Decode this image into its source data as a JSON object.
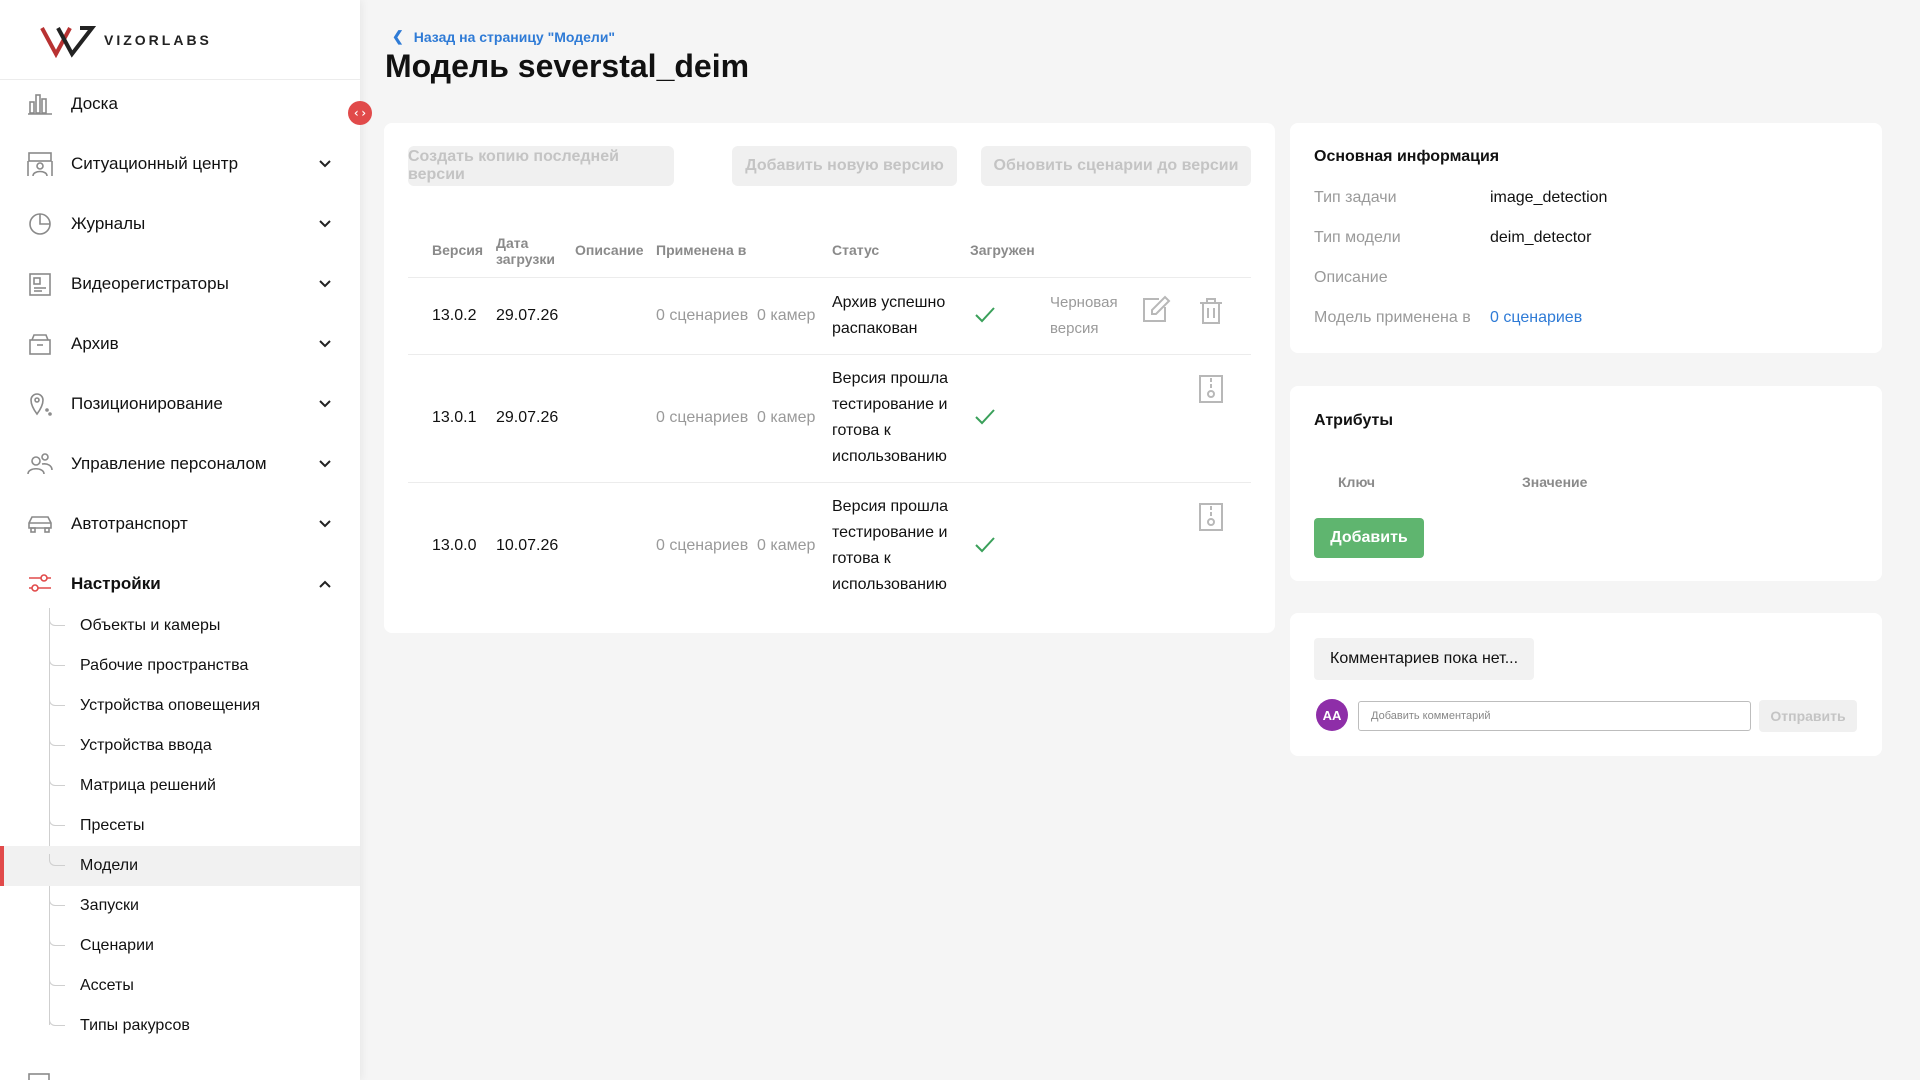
{
  "brand": {
    "name": "VIZORLABS"
  },
  "sidebar": {
    "items": [
      {
        "label": "Доска",
        "icon": "chart-bars-icon"
      },
      {
        "label": "Ситуационный центр",
        "icon": "monitoring-center-icon"
      },
      {
        "label": "Журналы",
        "icon": "pie-chart-icon"
      },
      {
        "label": "Видеорегистраторы",
        "icon": "video-recorder-icon"
      },
      {
        "label": "Архив",
        "icon": "archive-box-icon"
      },
      {
        "label": "Позиционирование",
        "icon": "location-pin-icon"
      },
      {
        "label": "Управление персоналом",
        "icon": "people-icon"
      },
      {
        "label": "Автотранспорт",
        "icon": "car-icon"
      },
      {
        "label": "Настройки",
        "icon": "sliders-icon"
      }
    ],
    "settings_sub": [
      "Объекты и камеры",
      "Рабочие пространства",
      "Устройства оповещения",
      "Устройства ввода",
      "Матрица решений",
      "Пресеты",
      "Модели",
      "Запуски",
      "Сценарии",
      "Ассеты",
      "Типы ракурсов"
    ],
    "active_sub": "Модели",
    "accent_color": "#e14a4a"
  },
  "header": {
    "back_link": "Назад на страницу \"Модели\"",
    "title": "Модель severstal_deim"
  },
  "toolbar": {
    "copy_last_version": "Создать копию последней версии",
    "add_new_version": "Добавить новую версию",
    "update_scenarios": "Обновить сценарии до версии"
  },
  "table": {
    "headers": {
      "version": "Версия",
      "upload_date": "Дата загрузки",
      "description": "Описание",
      "applied_in": "Применена в",
      "status": "Статус",
      "loaded": "Загружен"
    },
    "rows": [
      {
        "version": "13.0.2",
        "date": "29.07.26",
        "scenarios": "0 сценариев",
        "cameras": "0 камер",
        "status": "Архив успешно распакован",
        "draft": "Черновая версия"
      },
      {
        "version": "13.0.1",
        "date": "29.07.26",
        "scenarios": "0 сценариев",
        "cameras": "0 камер",
        "status": "Версия прошла тестирование и готова к использованию"
      },
      {
        "version": "13.0.0",
        "date": "10.07.26",
        "scenarios": "0 сценариев",
        "cameras": "0 камер",
        "status": "Версия прошла тестирование и готова к использованию"
      }
    ]
  },
  "info": {
    "title": "Основная информация",
    "task_type_label": "Тип задачи",
    "task_type_value": "image_detection",
    "model_type_label": "Тип модели",
    "model_type_value": "deim_detector",
    "description_label": "Описание",
    "applied_label": "Модель применена в",
    "applied_value": "0 сценариев"
  },
  "attributes": {
    "title": "Атрибуты",
    "key_header": "Ключ",
    "value_header": "Значение",
    "add_button": "Добавить"
  },
  "comments": {
    "empty_text": "Комментариев пока нет...",
    "avatar_initials": "AA",
    "input_placeholder": "Добавить комментарий",
    "send_button": "Отправить"
  },
  "colors": {
    "link": "#2f7bd6",
    "success": "#5fb56f",
    "check": "#3aa05a",
    "avatar": "#8e2ea8"
  }
}
